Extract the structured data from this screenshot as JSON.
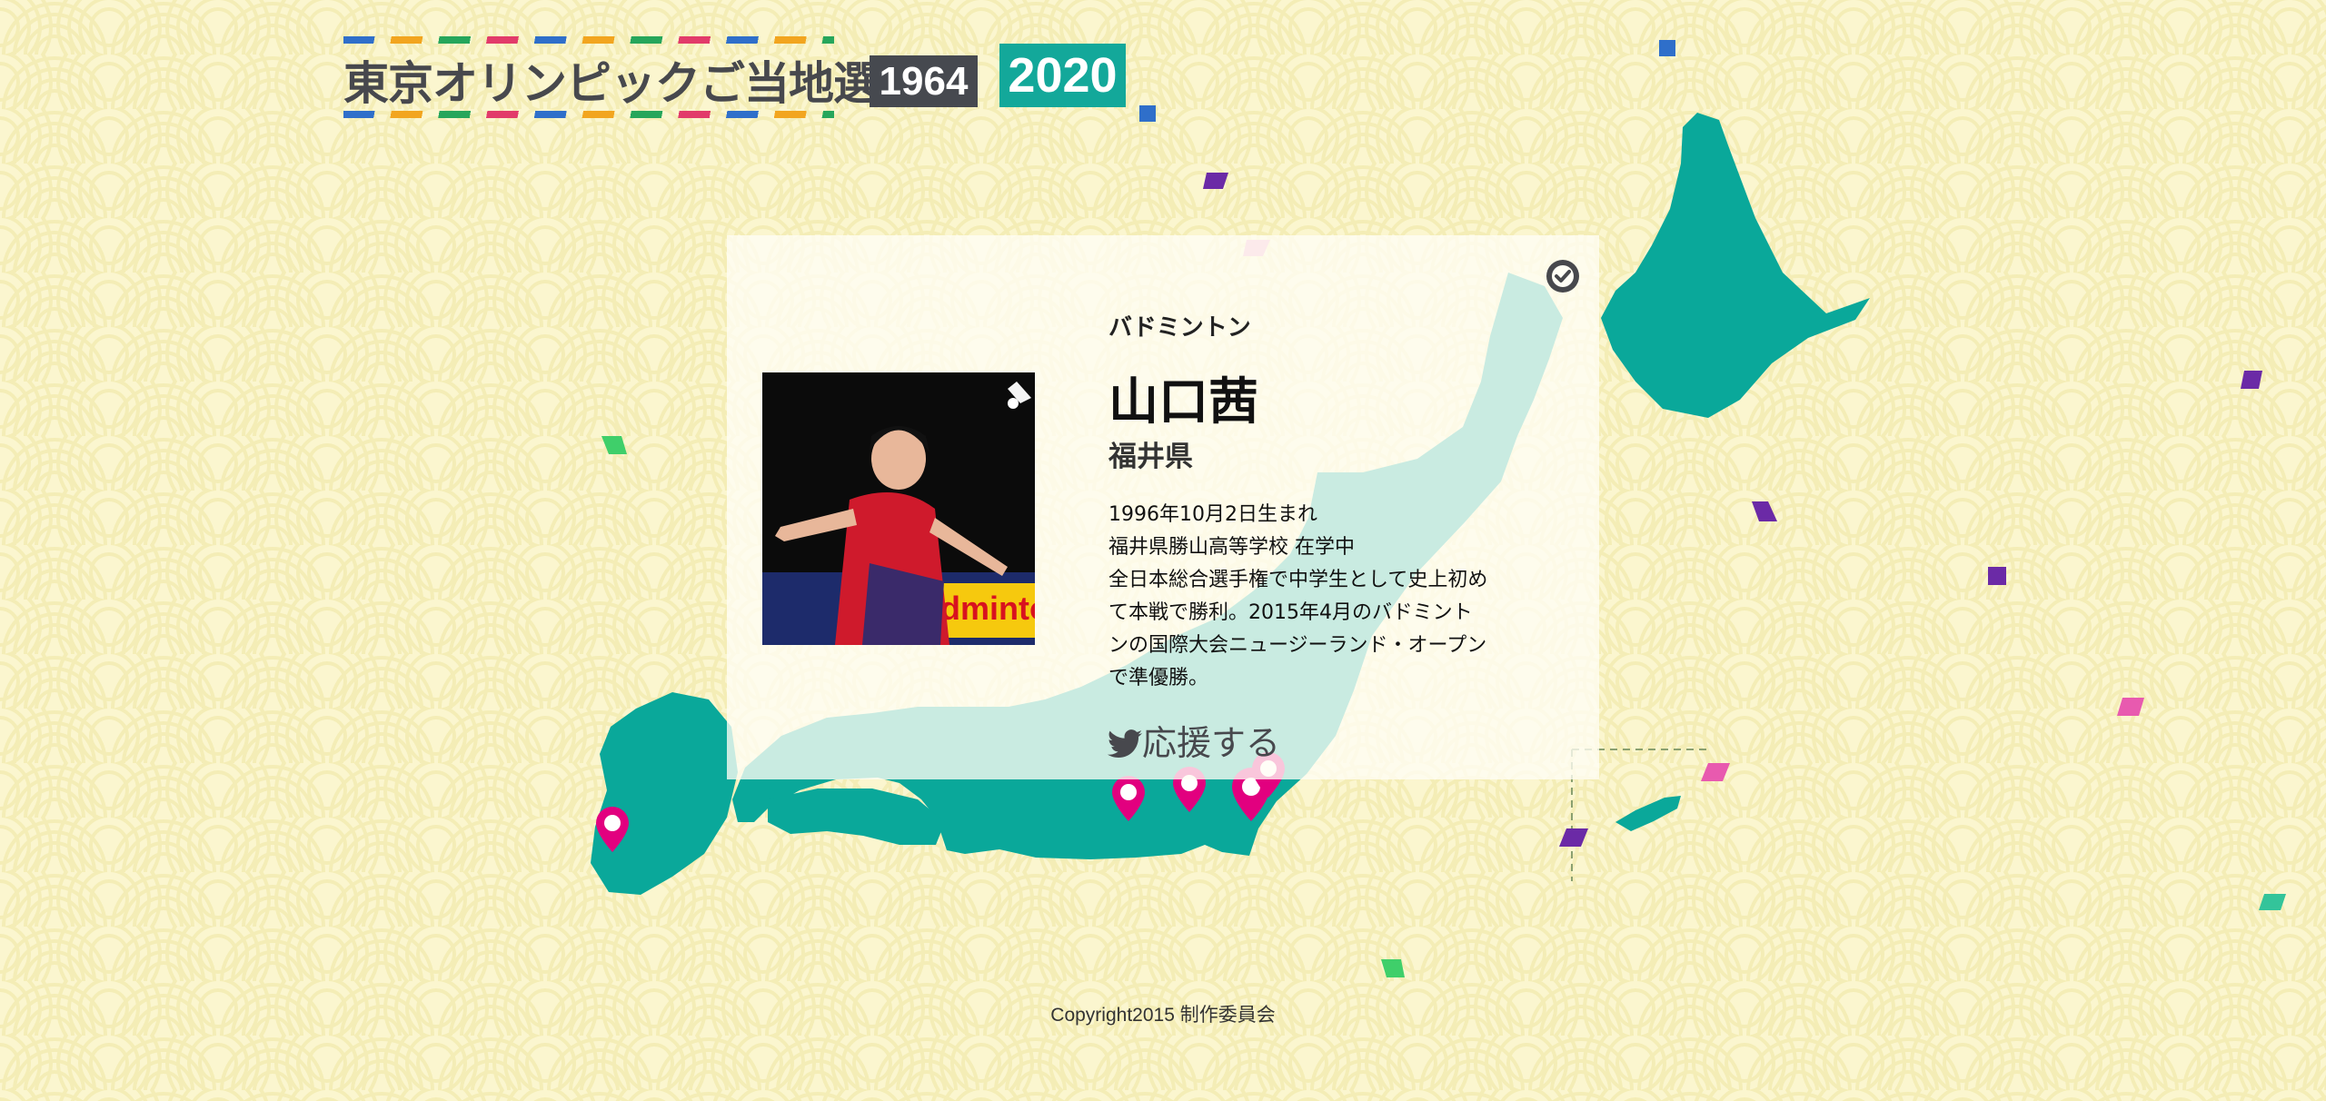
{
  "header": {
    "site_title": "東京オリンピックご当地選手",
    "year_1964": "1964",
    "year_2020": "2020"
  },
  "profile": {
    "sport": "バドミントン",
    "name": "山口茜",
    "prefecture": "福井県",
    "bio_lines": [
      "1996年10月2日生まれ",
      "福井県勝山高等学校 在学中",
      "全日本総合選手権で中学生として史上初め",
      "て本戦で勝利。2015年4月のバドミント",
      "ンの国際大会ニュージーランド・オープン",
      "で準優勝。"
    ],
    "support_label": "応援する",
    "photo_banner_text": "Badminton",
    "close_icon": "check-circle-icon",
    "support_icon": "twitter-bird-icon"
  },
  "footer": {
    "copyright": "Copyright2015 制作委員会"
  },
  "colors": {
    "background": "#fbf6cf",
    "map_teal": "#0aa89a",
    "map_light": "#c8ecea",
    "pin_pink": "#e2007f",
    "badge_dark": "#46494f",
    "badge_teal": "#13a89a"
  }
}
